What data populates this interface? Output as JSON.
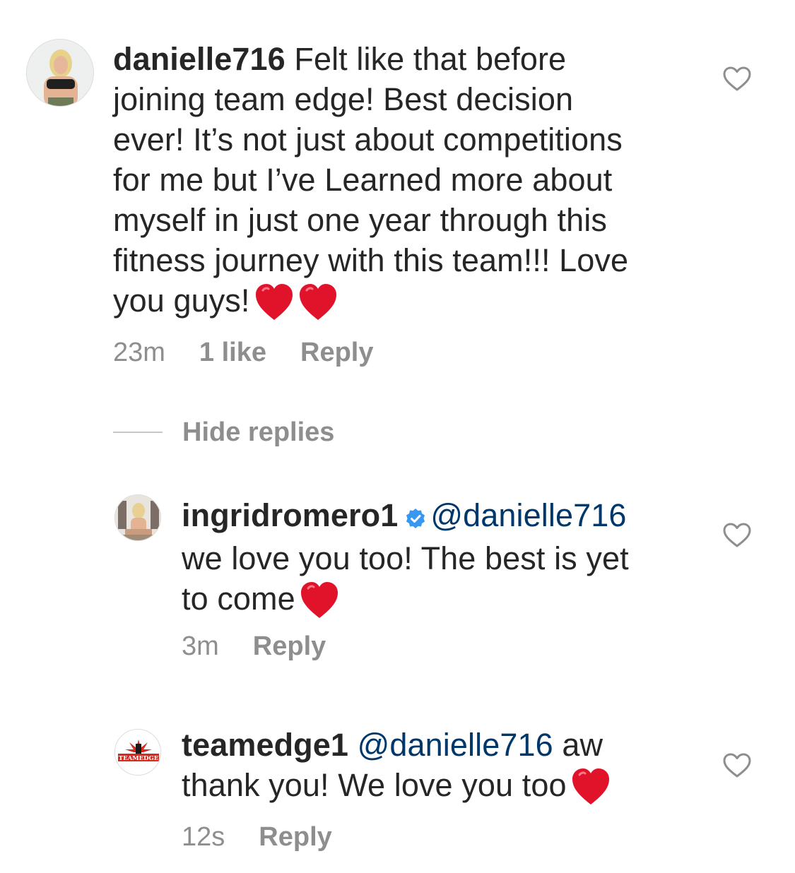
{
  "comments": [
    {
      "username": "danielle716",
      "text_lines": [
        "Felt like that before",
        "joining team edge! Best decision",
        "ever! It’s not just about competitions",
        "for me but I’ve Learned more about",
        "myself in just one year through this",
        "fitness journey with this team!!! Love",
        "you guys!"
      ],
      "emoji": "heart-emoji x2",
      "time": "23m",
      "likes": "1 like",
      "reply_label": "Reply"
    }
  ],
  "hide_replies_label": "Hide replies",
  "replies": [
    {
      "username": "ingridromero1",
      "verified": true,
      "mention": "@danielle716",
      "text_lines": [
        "we love you too! The best is yet",
        "to come"
      ],
      "time": "3m",
      "reply_label": "Reply"
    },
    {
      "username": "teamedge1",
      "mention": "@danielle716",
      "text_after_mention": "aw",
      "text_lines": [
        "thank you! We love you too"
      ],
      "time": "12s",
      "reply_label": "Reply",
      "avatar_text": "TEAMEDGE"
    }
  ],
  "colors": {
    "text": "#262626",
    "secondary": "#8e8e8e",
    "mention": "#00376b",
    "verified": "#3897f0",
    "heart": "#e0132b"
  }
}
